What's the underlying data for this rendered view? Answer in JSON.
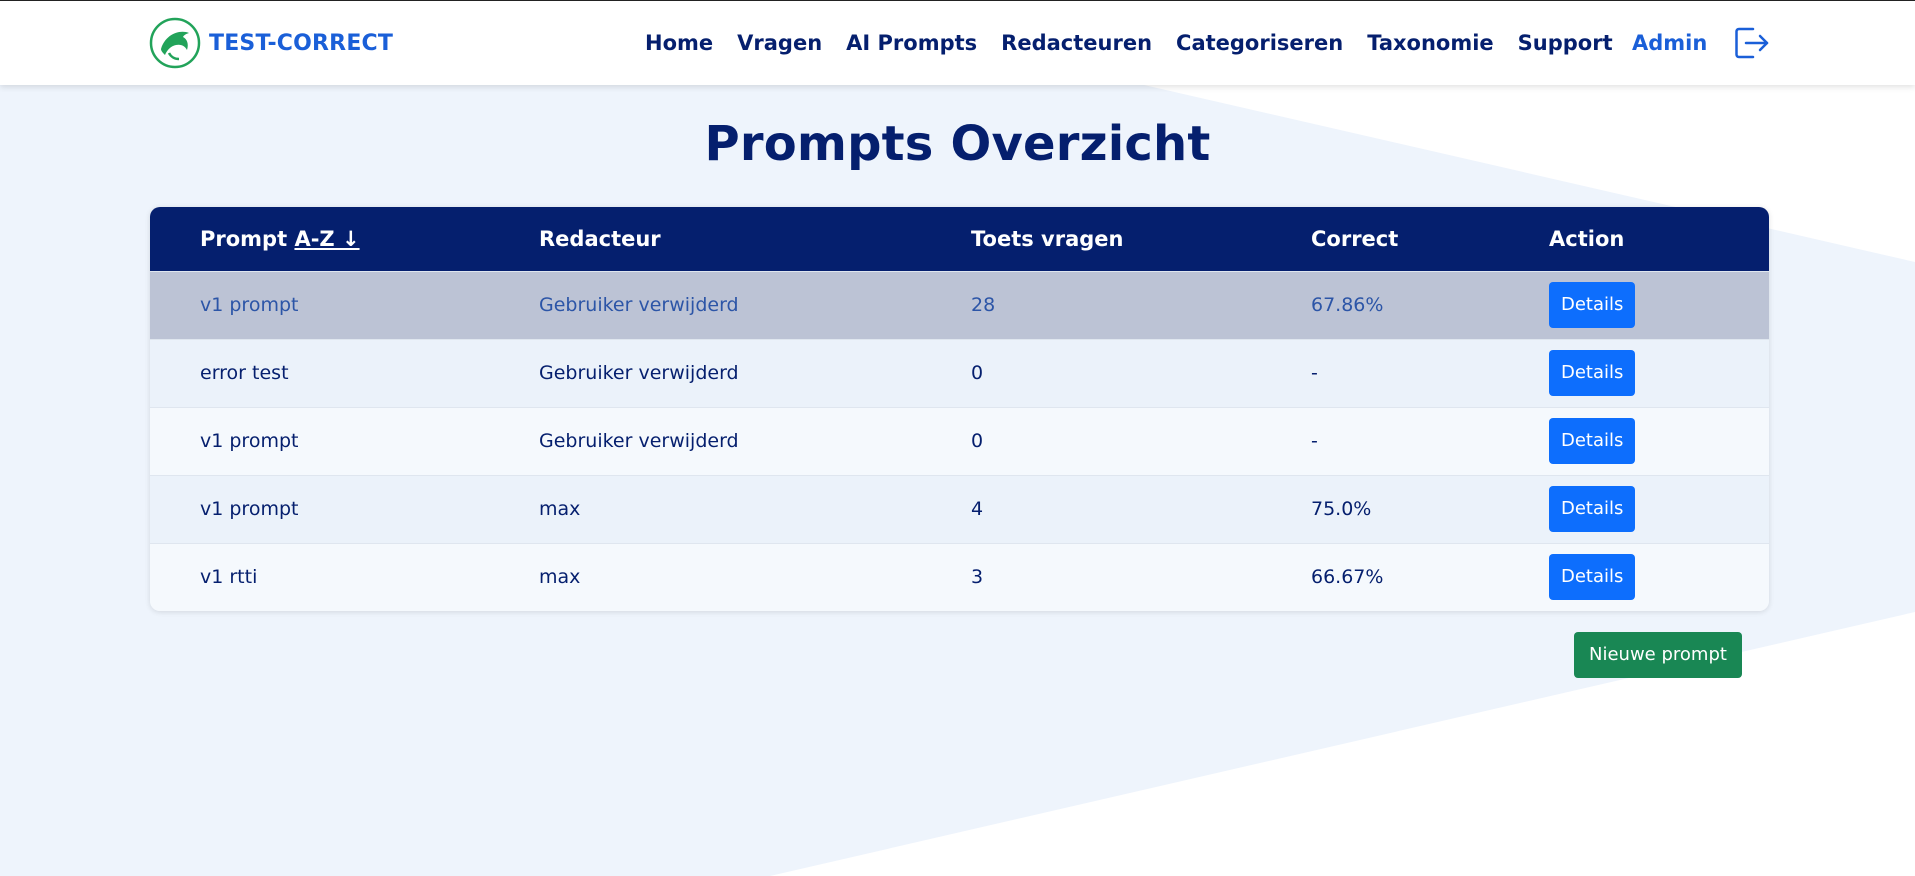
{
  "app": {
    "brand_name": "TEST-CORRECT",
    "accent_color": "#1a5fd8",
    "dark_color": "#051f6e"
  },
  "nav": {
    "items": [
      "Home",
      "Vragen",
      "AI Prompts",
      "Redacteuren",
      "Categoriseren",
      "Taxonomie",
      "Support"
    ]
  },
  "user": {
    "name": "Admin",
    "logout_icon": "logout-icon"
  },
  "page": {
    "title": "Prompts Overzicht"
  },
  "table": {
    "columns": {
      "prompt": "Prompt",
      "sort": "A-Z ↓",
      "redacteur": "Redacteur",
      "toets_vragen": "Toets vragen",
      "correct": "Correct",
      "action": "Action"
    },
    "rows": [
      {
        "prompt": "v1 prompt",
        "redacteur": "Gebruiker verwijderd",
        "toets_vragen": "28",
        "correct": "67.86%",
        "action": "Details"
      },
      {
        "prompt": "error test",
        "redacteur": "Gebruiker verwijderd",
        "toets_vragen": "0",
        "correct": "-",
        "action": "Details"
      },
      {
        "prompt": "v1 prompt",
        "redacteur": "Gebruiker verwijderd",
        "toets_vragen": "0",
        "correct": "-",
        "action": "Details"
      },
      {
        "prompt": "v1 prompt",
        "redacteur": "max",
        "toets_vragen": "4",
        "correct": "75.0%",
        "action": "Details"
      },
      {
        "prompt": "v1 rtti",
        "redacteur": "max",
        "toets_vragen": "3",
        "correct": "66.67%",
        "action": "Details"
      }
    ]
  },
  "actions": {
    "new_prompt": "Nieuwe prompt"
  }
}
